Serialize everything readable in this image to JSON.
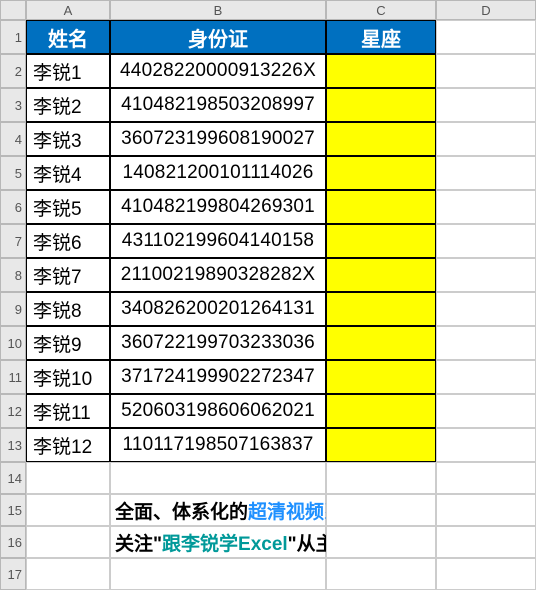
{
  "columns": [
    "A",
    "B",
    "C",
    "D"
  ],
  "rowNumbers": [
    1,
    2,
    3,
    4,
    5,
    6,
    7,
    8,
    9,
    10,
    11,
    12,
    13,
    14,
    15,
    16,
    17
  ],
  "headers": {
    "a": "姓名",
    "b": "身份证",
    "c": "星座"
  },
  "rows": [
    {
      "name": "李锐1",
      "id": "44028220000913226X"
    },
    {
      "name": "李锐2",
      "id": "410482198503208997"
    },
    {
      "name": "李锐3",
      "id": "360723199608190027"
    },
    {
      "name": "李锐4",
      "id": "140821200101114026"
    },
    {
      "name": "李锐5",
      "id": "410482199804269301"
    },
    {
      "name": "李锐6",
      "id": "431102199604140158"
    },
    {
      "name": "李锐7",
      "id": "21100219890328282X"
    },
    {
      "name": "李锐8",
      "id": "340826200201264131"
    },
    {
      "name": "李锐9",
      "id": "360722199703233036"
    },
    {
      "name": "李锐10",
      "id": "371724199902272347"
    },
    {
      "name": "李锐11",
      "id": "520603198606062021"
    },
    {
      "name": "李锐12",
      "id": "110117198507163837"
    }
  ],
  "footer": {
    "line1a": "全面、体系化的",
    "line1b": "超清视频系统课程↓",
    "line2a": "关注\"",
    "line2b": "跟李锐学Excel",
    "line2c": "\"从主页获取"
  }
}
